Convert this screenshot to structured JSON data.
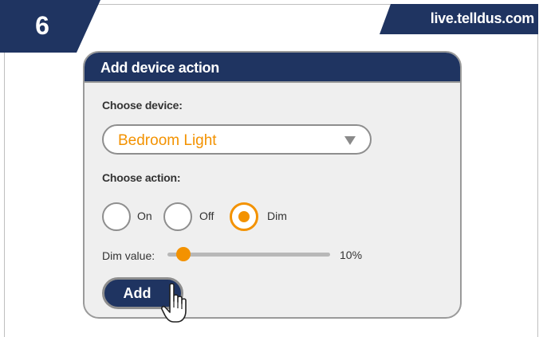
{
  "step": {
    "number": "6"
  },
  "site": {
    "url": "live.telldus.com"
  },
  "dialog": {
    "title": "Add device action",
    "choose_device_label": "Choose device:",
    "device_select": {
      "value": "Bedroom Light"
    },
    "choose_action_label": "Choose action:",
    "actions": [
      {
        "label": "On",
        "selected": false
      },
      {
        "label": "Off",
        "selected": false
      },
      {
        "label": "Dim",
        "selected": true
      }
    ],
    "dim": {
      "label": "Dim value:",
      "value_text": "10%",
      "value_fraction": 0.1
    },
    "add_button": {
      "label": "Add"
    }
  },
  "colors": {
    "navy": "#1f3461",
    "accent": "#f39200",
    "panel": "#efefef",
    "border": "#9a9a9a"
  },
  "icons": [
    "select-caret-icon",
    "hand-pointer-cursor-icon"
  ]
}
